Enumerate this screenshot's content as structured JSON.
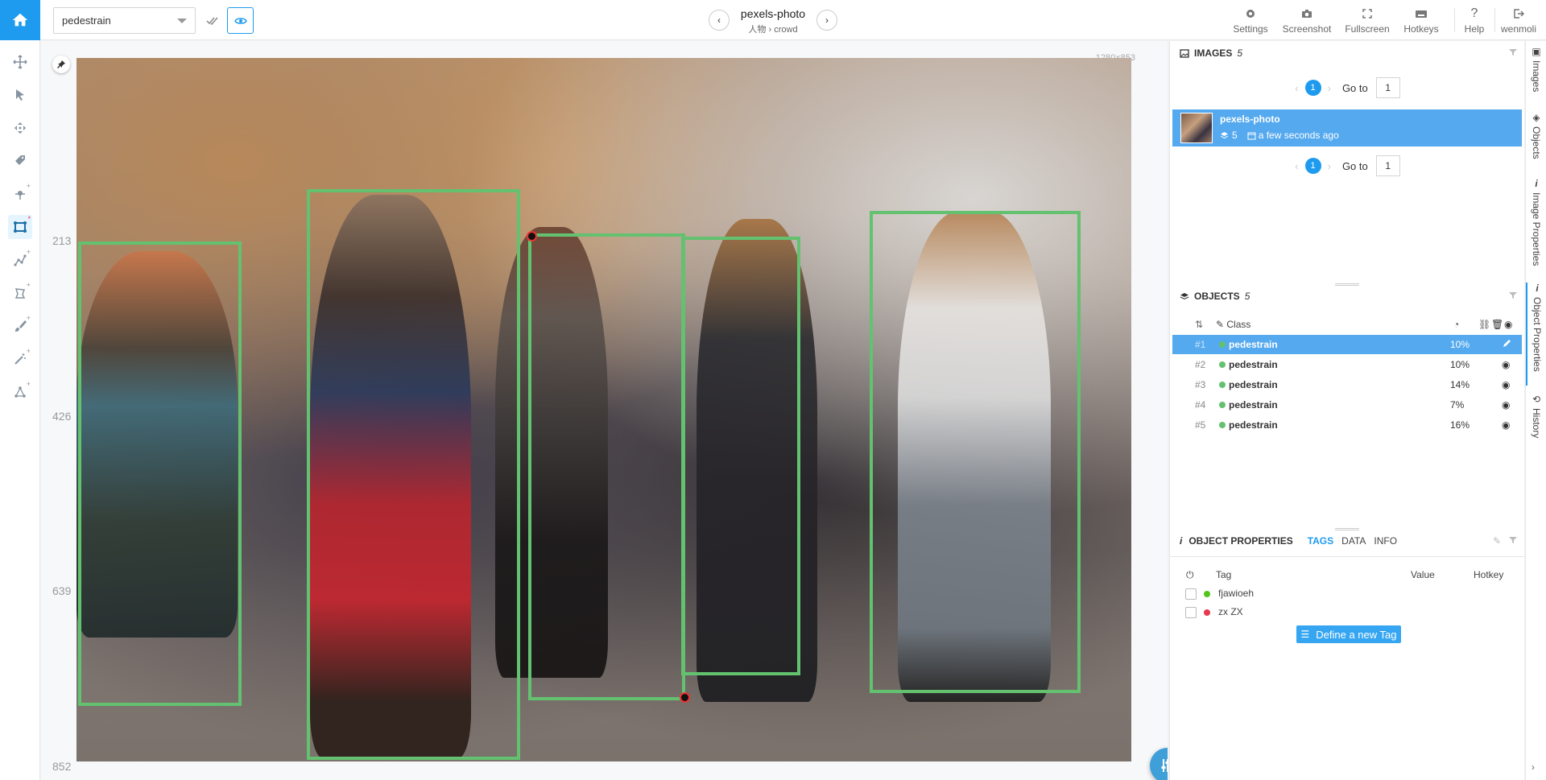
{
  "topbar": {
    "class_select_value": "pedestrain",
    "image_name": "pexels-photo",
    "breadcrumb_part1": "人物",
    "breadcrumb_sep": "›",
    "breadcrumb_part2": "crowd",
    "right_tools": [
      {
        "label": "Settings",
        "icon": "gear-icon"
      },
      {
        "label": "Screenshot",
        "icon": "camera-icon"
      },
      {
        "label": "Fullscreen",
        "icon": "fullscreen-icon"
      },
      {
        "label": "Hotkeys",
        "icon": "keyboard-icon"
      },
      {
        "label": "Help",
        "icon": "question-icon"
      },
      {
        "label": "wenmoli",
        "icon": "logout-icon"
      }
    ]
  },
  "left_tools": [
    {
      "name": "move-tool",
      "icon": "move-icon",
      "sup": ""
    },
    {
      "name": "select-tool",
      "icon": "cursor-icon",
      "sup": ""
    },
    {
      "name": "pan-tool",
      "icon": "pan-icon",
      "sup": ""
    },
    {
      "name": "tag-tool",
      "icon": "tag-icon",
      "sup": ""
    },
    {
      "name": "point-tool",
      "icon": "point-icon",
      "sup": "+"
    },
    {
      "name": "rectangle-tool",
      "icon": "rectangle-icon",
      "sup": "*"
    },
    {
      "name": "polyline-tool",
      "icon": "polyline-icon",
      "sup": "+"
    },
    {
      "name": "polygon-tool",
      "icon": "polygon-icon",
      "sup": "+"
    },
    {
      "name": "brush-tool",
      "icon": "brush-icon",
      "sup": "+"
    },
    {
      "name": "magic-tool",
      "icon": "magic-wand-icon",
      "sup": "+"
    },
    {
      "name": "skeleton-tool",
      "icon": "skeleton-icon",
      "sup": "+"
    }
  ],
  "canvas": {
    "coords": "1280×853",
    "ruler": [
      "213",
      "426",
      "639",
      "852"
    ]
  },
  "images_panel": {
    "title": "IMAGES",
    "count": "5",
    "page": "1",
    "goto_label": "Go to",
    "goto_value": "1",
    "item": {
      "name": "pexels-photo",
      "objects": "5",
      "time": "a few seconds ago"
    }
  },
  "objects_panel": {
    "title": "OBJECTS",
    "count": "5",
    "class_header": "Class",
    "rows": [
      {
        "idx": "#1",
        "cls": "pedestrain",
        "pct": "10%"
      },
      {
        "idx": "#2",
        "cls": "pedestrain",
        "pct": "10%"
      },
      {
        "idx": "#3",
        "cls": "pedestrain",
        "pct": "14%"
      },
      {
        "idx": "#4",
        "cls": "pedestrain",
        "pct": "7%"
      },
      {
        "idx": "#5",
        "cls": "pedestrain",
        "pct": "16%"
      }
    ]
  },
  "object_properties": {
    "title": "OBJECT PROPERTIES",
    "tabs": [
      "TAGS",
      "DATA",
      "INFO"
    ],
    "columns": [
      "Tag",
      "Value",
      "Hotkey"
    ],
    "tags": [
      {
        "name": "fjawioeh",
        "color": "#52c41a"
      },
      {
        "name": "zx ZX",
        "color": "#e8384f"
      }
    ],
    "define_button": "Define a new Tag"
  },
  "vertical_tabs": [
    "Images",
    "Objects",
    "Image Properties",
    "Object Properties",
    "History"
  ],
  "colors": {
    "accent": "#1e9bef",
    "bbox": "#63c16f",
    "selected": "#55a9ef"
  }
}
